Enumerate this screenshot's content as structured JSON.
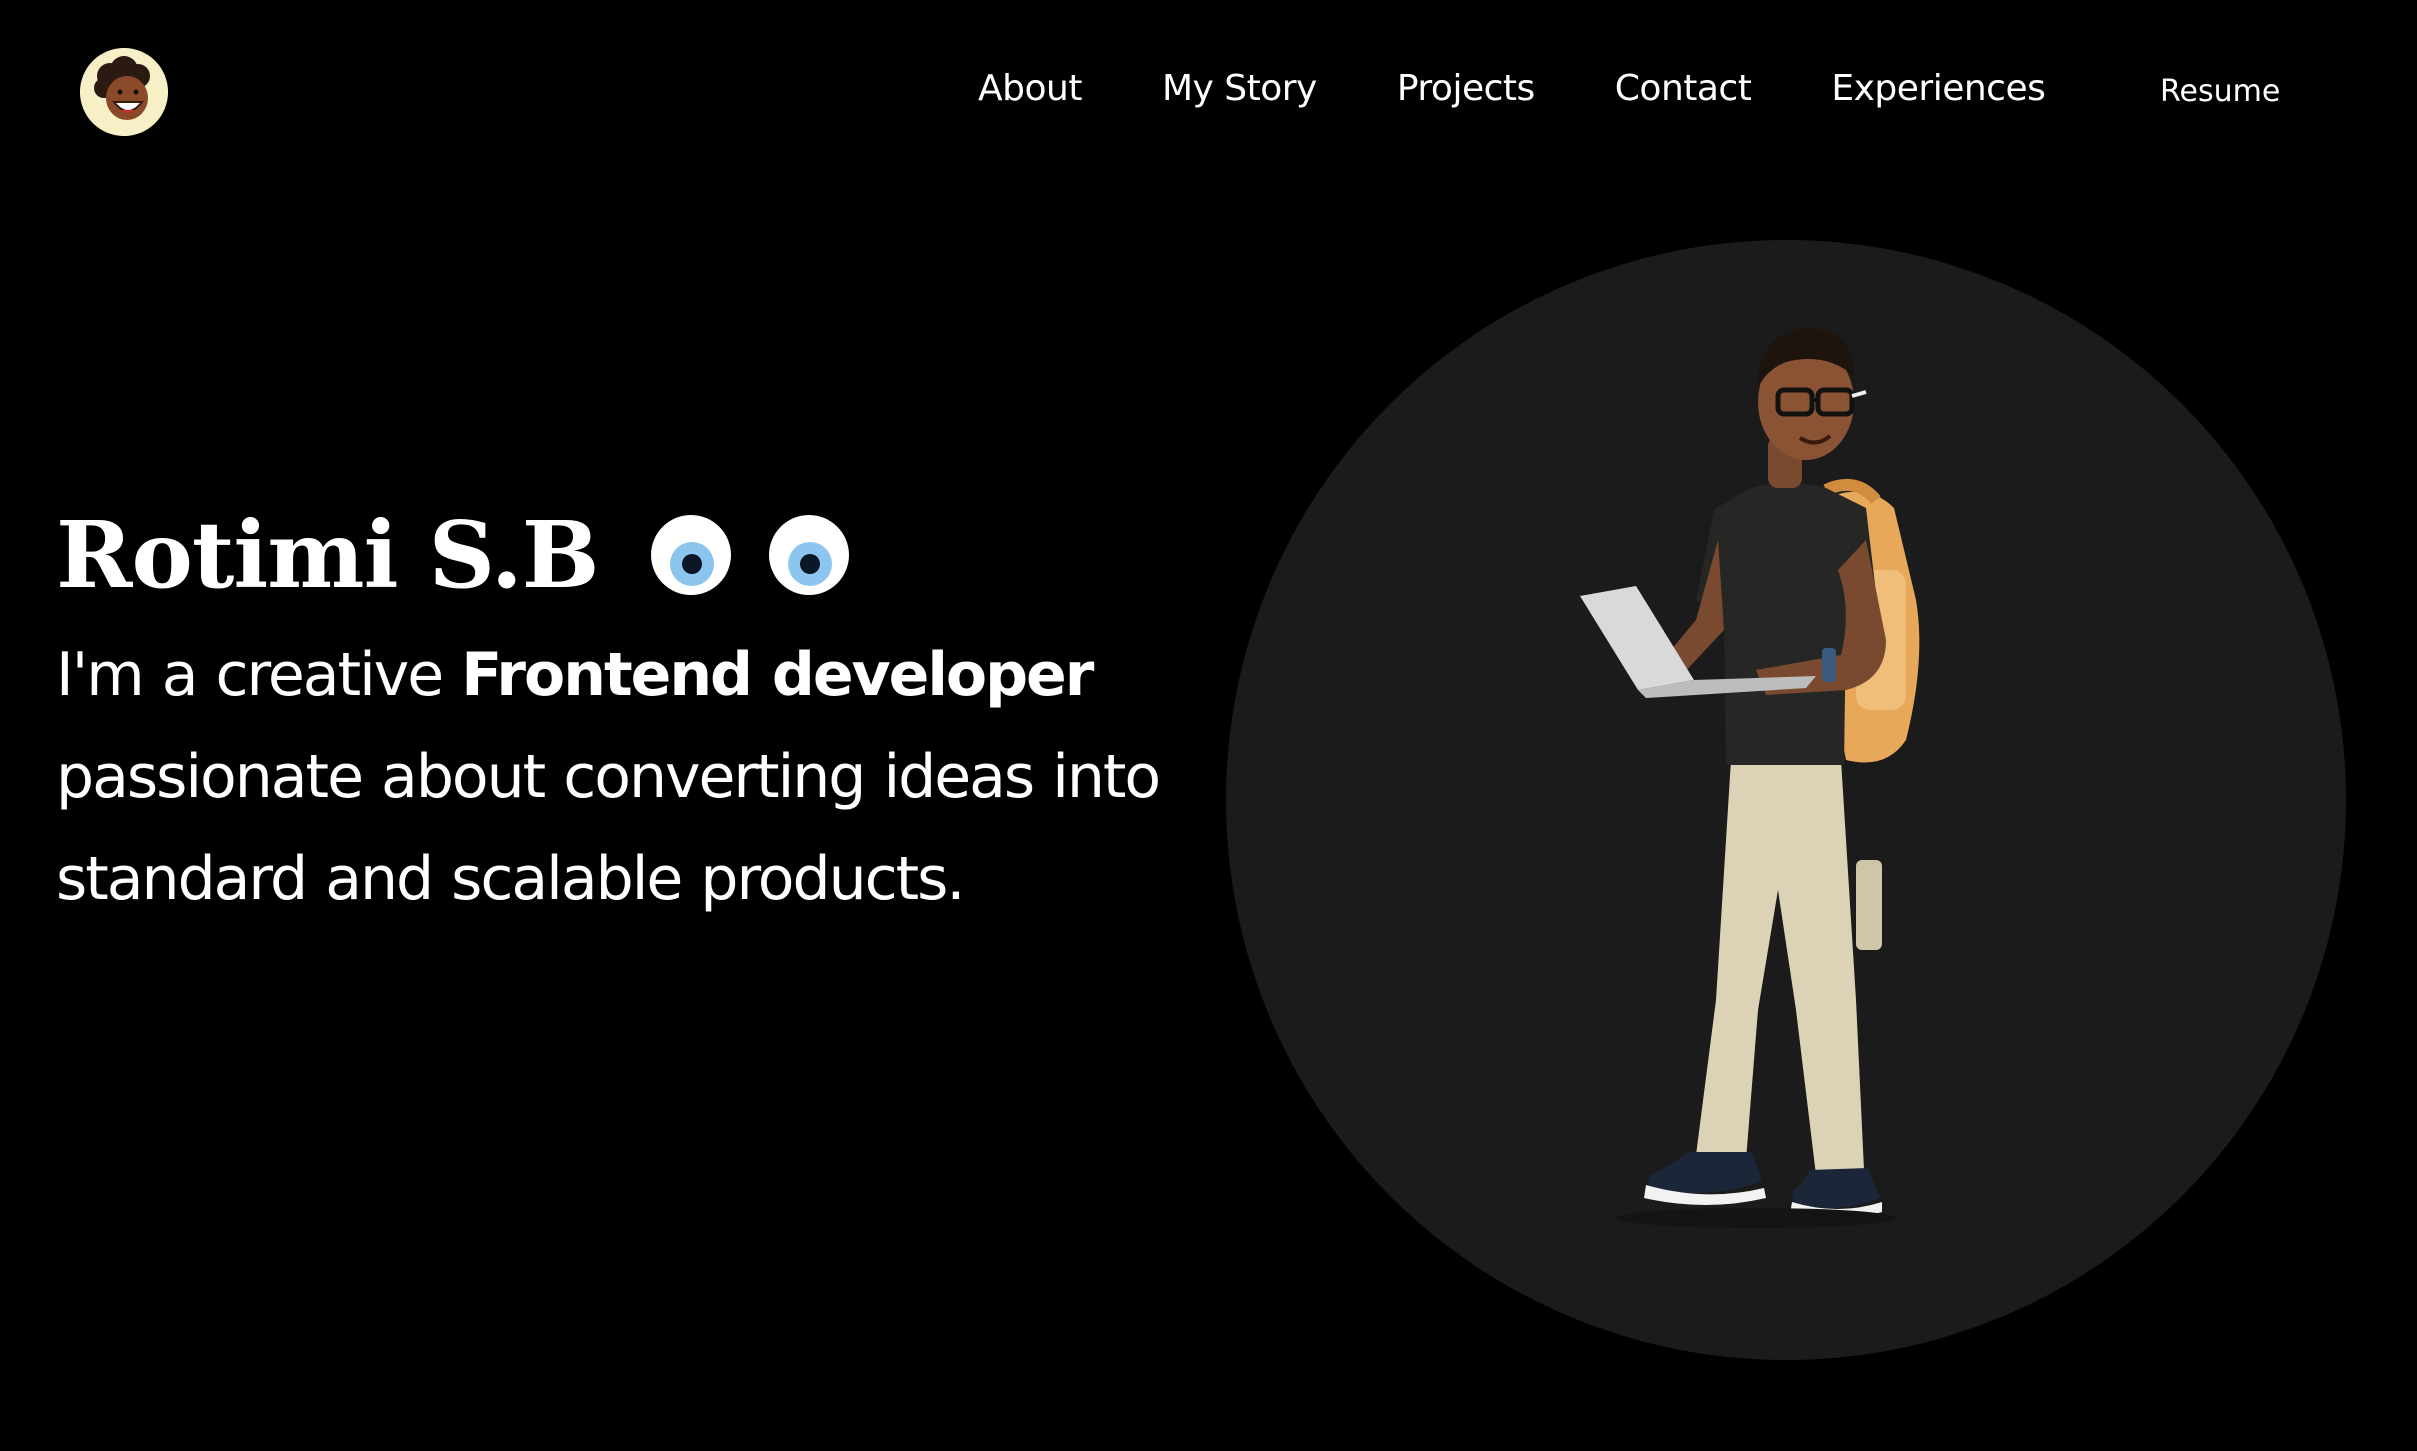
{
  "header": {
    "nav": [
      {
        "label": "About"
      },
      {
        "label": "My Story"
      },
      {
        "label": "Projects"
      },
      {
        "label": "Contact"
      },
      {
        "label": "Experiences"
      }
    ],
    "resume_label": "Resume"
  },
  "hero": {
    "name": "Rotimi S.B",
    "tagline_intro": "I'm a creative ",
    "tagline_strong": "Frontend developer",
    "tagline_rest": " passionate about converting ideas into standard and scalable products."
  },
  "icons": {
    "logo": "cartoon-face-logo",
    "eyes": "googly-eyes-icon",
    "illustration": "developer-avatar-illustration"
  },
  "colors": {
    "background": "#000000",
    "text": "#ffffff",
    "circle": "#1b1b1b",
    "logo_bg": "#f7efc6",
    "iris": "#8cc6ee"
  }
}
